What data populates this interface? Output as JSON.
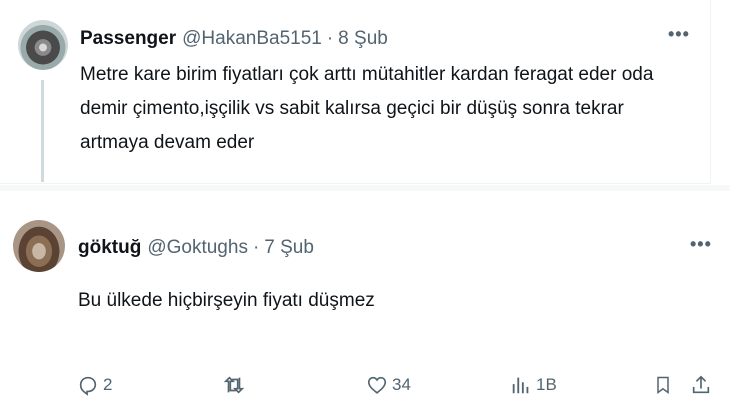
{
  "tweets": [
    {
      "name": "Passenger",
      "handle": "@HakanBa5151",
      "separator": "·",
      "date": "8 Şub",
      "text": "Metre kare birim fiyatları çok arttı mütahitler kardan feragat eder oda demir çimento,işçilik vs sabit kalırsa geçici bir düşüş sonra tekrar artmaya devam eder",
      "more_label": "•••"
    },
    {
      "name": "göktuğ",
      "handle": "@Goktughs",
      "separator": "·",
      "date": "7 Şub",
      "text": "Bu ülkede hiçbirşeyin fiyatı düşmez",
      "more_label": "•••"
    }
  ],
  "actions": {
    "reply_count": "2",
    "retweet_count": "",
    "like_count": "34",
    "views_count": "1B"
  },
  "icons": [
    "more-icon",
    "reply-icon",
    "retweet-icon",
    "like-icon",
    "views-icon",
    "bookmark-icon",
    "share-icon"
  ],
  "colors": {
    "text": "#0f1419",
    "secondary": "#536471",
    "thread_line": "#cfd9de"
  }
}
